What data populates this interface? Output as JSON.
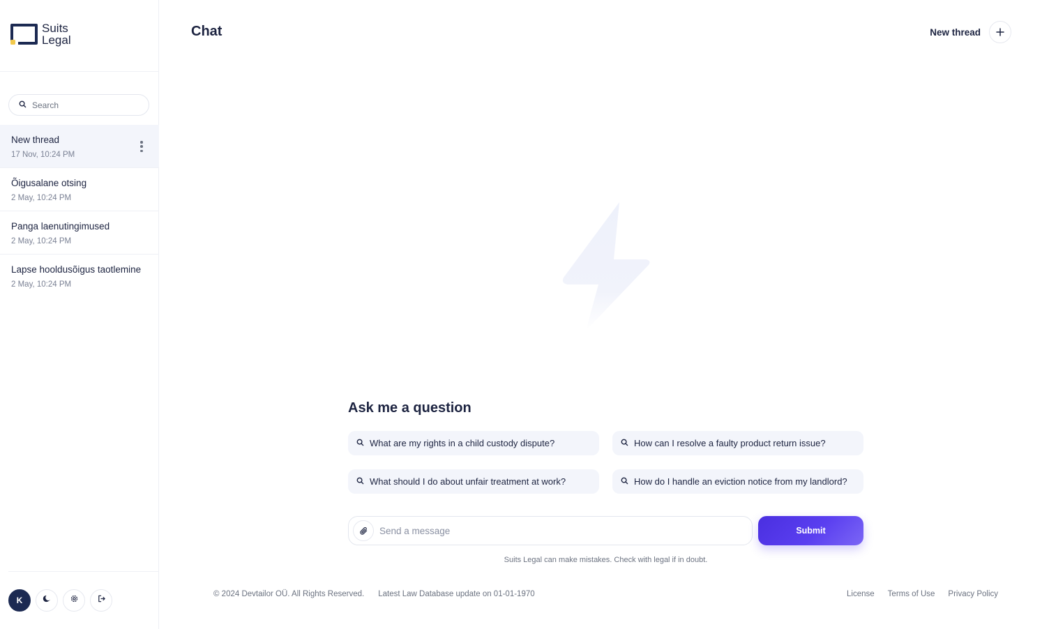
{
  "brand": {
    "line1": "Suits",
    "line2": "Legal",
    "accent": "#f2c94c",
    "primary": "#1c2a52"
  },
  "sidebar": {
    "search_placeholder": "Search",
    "threads": [
      {
        "title": "New thread",
        "date": "17 Nov, 10:24 PM"
      },
      {
        "title": "Õigusalane otsing",
        "date": "2 May, 10:24 PM"
      },
      {
        "title": "Panga laenutingimused",
        "date": "2 May, 10:24 PM"
      },
      {
        "title": "Lapse hooldusõigus taotlemine",
        "date": "2 May, 10:24 PM"
      }
    ],
    "avatar_initial": "K",
    "bottom_icons": [
      "moon-icon",
      "gear-icon",
      "logout-icon"
    ]
  },
  "header": {
    "title": "Chat",
    "new_thread_label": "New thread"
  },
  "main": {
    "ask_title": "Ask me a question",
    "suggestions": [
      "What are my rights in a child custody dispute?",
      "How can I resolve a faulty product return issue?",
      "What should I do about unfair treatment at work?",
      "How do I handle an eviction notice from my landlord?"
    ],
    "message_placeholder": "Send a message",
    "submit_label": "Submit",
    "disclaimer": "Suits Legal can make mistakes. Check with legal if in doubt.",
    "accent_color": "#5436ec"
  },
  "footer": {
    "copyright": "© 2024 Devtailor OÜ. All Rights Reserved.",
    "db_update": "Latest Law Database update on 01-01-1970",
    "links": [
      "License",
      "Terms of Use",
      "Privacy Policy"
    ]
  }
}
